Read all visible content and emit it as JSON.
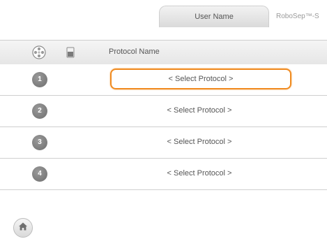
{
  "top_bar": {
    "user_tab_label": "User Name",
    "brand_label": "RoboSep™-S"
  },
  "table": {
    "column_header": "Protocol Name",
    "header_icons": [
      "cell-separation-icon",
      "vial-icon"
    ],
    "rows": [
      {
        "number": "1",
        "protocol": "< Select Protocol >",
        "selected": true
      },
      {
        "number": "2",
        "protocol": "< Select Protocol >",
        "selected": false
      },
      {
        "number": "3",
        "protocol": "< Select Protocol >",
        "selected": false
      },
      {
        "number": "4",
        "protocol": "< Select Protocol >",
        "selected": false
      }
    ]
  },
  "footer": {
    "home_icon": "home-icon"
  },
  "colors": {
    "selection_outline": "#f08a1f",
    "badge": "#7a7a7a"
  }
}
